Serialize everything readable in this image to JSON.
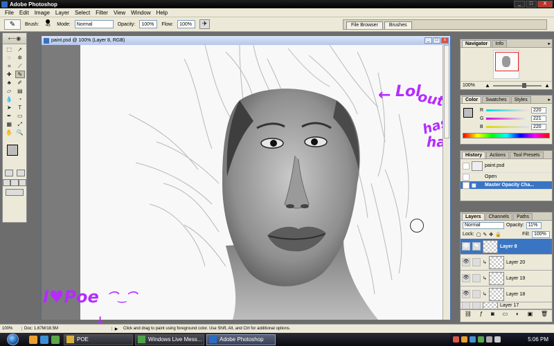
{
  "window": {
    "title": "Adobe Photoshop",
    "controls": [
      "_",
      "□",
      "X"
    ]
  },
  "menu": [
    "File",
    "Edit",
    "Image",
    "Layer",
    "Select",
    "Filter",
    "View",
    "Window",
    "Help"
  ],
  "options": {
    "brush_label": "Brush:",
    "brush_size": "45",
    "mode_label": "Mode:",
    "mode_value": "Normal",
    "opacity_label": "Opacity:",
    "opacity_value": "100%",
    "flow_label": "Flow:",
    "flow_value": "100%",
    "well_tabs": [
      "File Browser",
      "Brushes"
    ]
  },
  "document": {
    "title": "paint.psd @ 100% (Layer 8, RGB)",
    "controls": [
      "_",
      "□",
      "x"
    ]
  },
  "annotations": {
    "lol": "Lol",
    "outline": "outline",
    "has_big": "has big",
    "hair": "hair",
    "i_love_poe": "I♥Poe",
    "smiley": "⌒‿⌒"
  },
  "navigator": {
    "tabs": [
      "Navigator",
      "Info"
    ],
    "zoom": "100%"
  },
  "color": {
    "tabs": [
      "Color",
      "Swatches",
      "Styles"
    ],
    "channels": [
      {
        "name": "R",
        "value": "220",
        "track": "linear-gradient(to right,#00dcdc,#ffdcdc)"
      },
      {
        "name": "G",
        "value": "221",
        "track": "linear-gradient(to right,#dc00dc,#dcffdc)"
      },
      {
        "name": "B",
        "value": "220",
        "track": "linear-gradient(to right,#dcdc00,#dcdcff)"
      }
    ]
  },
  "history": {
    "tabs": [
      "History",
      "Actions",
      "Tool Presets"
    ],
    "snapshot": "paint.psd",
    "items": [
      {
        "label": "Open",
        "selected": false
      },
      {
        "label": "Master Opacity Cha...",
        "selected": true
      }
    ]
  },
  "layers": {
    "tabs": [
      "Layers",
      "Channels",
      "Paths"
    ],
    "blend_mode": "Normal",
    "opacity_label": "Opacity:",
    "opacity_value": "11%",
    "lock_label": "Lock:",
    "fill_label": "Fill:",
    "fill_value": "100%",
    "items": [
      {
        "name": "Layer 8",
        "selected": true
      },
      {
        "name": "Layer 20",
        "selected": false
      },
      {
        "name": "Layer 19",
        "selected": false
      },
      {
        "name": "Layer 18",
        "selected": false
      },
      {
        "name": "Layer 17",
        "selected": false
      }
    ],
    "footer_icons": [
      "link-icon",
      "fx-icon",
      "mask-icon",
      "set-icon",
      "adjust-icon",
      "new-layer-icon",
      "trash-icon"
    ]
  },
  "status": {
    "zoom": "100%",
    "doc": "Doc: 1.67M/18.5M",
    "hint": "Click and drag to paint using foreground color.  Use Shift, Alt, and Ctrl for additional options."
  },
  "taskbar": {
    "tasks": [
      {
        "label": "POE",
        "active": false
      },
      {
        "label": "Windows Live Mess...",
        "active": false
      },
      {
        "label": "Adobe Photoshop",
        "active": true
      }
    ],
    "clock": "5:06 PM"
  },
  "colors": {
    "accent": "#3a75c4",
    "annotation": "#b52cff"
  }
}
